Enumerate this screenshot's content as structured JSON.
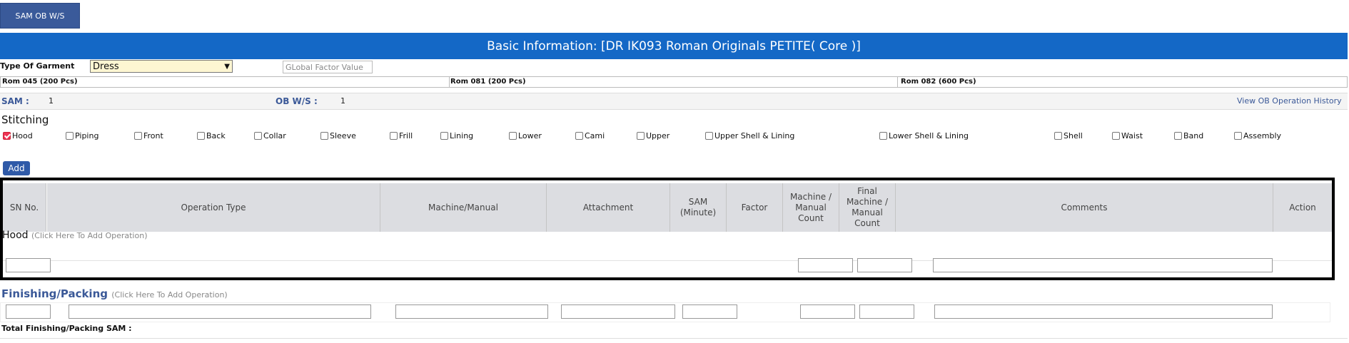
{
  "top_button": "SAM OB W/S",
  "banner": "Basic Information: [DR IK093 Roman Originals PETITE( Core )]",
  "garment": {
    "label": "Type Of Garment",
    "value": "Dress",
    "global_factor_placeholder": "GLobal Factor Value"
  },
  "roms": [
    "Rom 045 (200 Pcs)",
    "Rom 081 (200 Pcs)",
    "Rom 082 (600 Pcs)"
  ],
  "sam": {
    "sam_label": "SAM :",
    "sam_value": "1",
    "ob_label": "OB W/S :",
    "ob_value": "1",
    "history_link": "View OB Operation History"
  },
  "stitching": {
    "title": "Stitching",
    "options": [
      {
        "label": "Hood",
        "checked": true
      },
      {
        "label": "Piping",
        "checked": false
      },
      {
        "label": "Front",
        "checked": false
      },
      {
        "label": "Back",
        "checked": false
      },
      {
        "label": "Collar",
        "checked": false
      },
      {
        "label": "Sleeve",
        "checked": false
      },
      {
        "label": "Frill",
        "checked": false
      },
      {
        "label": "Lining",
        "checked": false
      },
      {
        "label": "Lower",
        "checked": false
      },
      {
        "label": "Cami",
        "checked": false
      },
      {
        "label": "Upper",
        "checked": false
      },
      {
        "label": "Upper Shell & Lining",
        "checked": false
      },
      {
        "label": "Lower Shell & Lining",
        "checked": false
      },
      {
        "label": "Shell",
        "checked": false
      },
      {
        "label": "Waist",
        "checked": false
      },
      {
        "label": "Band",
        "checked": false
      },
      {
        "label": "Assembly",
        "checked": false
      }
    ],
    "add_button": "Add"
  },
  "table": {
    "headers": [
      "SN No.",
      "Operation Type",
      "Machine/Manual",
      "Attachment",
      "SAM (Minute)",
      "Factor",
      "Machine / Manual Count",
      "Final Machine / Manual Count",
      "Comments",
      "Action"
    ],
    "section": "Hood",
    "section_hint": "(Click Here To Add Operation)"
  },
  "finishing": {
    "title": "Finishing/Packing",
    "hint": "(Click Here To Add Operation)",
    "total_label": "Total Finishing/Packing SAM :"
  },
  "colors": {
    "banner": "#1468c6",
    "button": "#2f5aa8",
    "select_bg": "#fdf6d2",
    "accent_text": "#3b5998"
  }
}
